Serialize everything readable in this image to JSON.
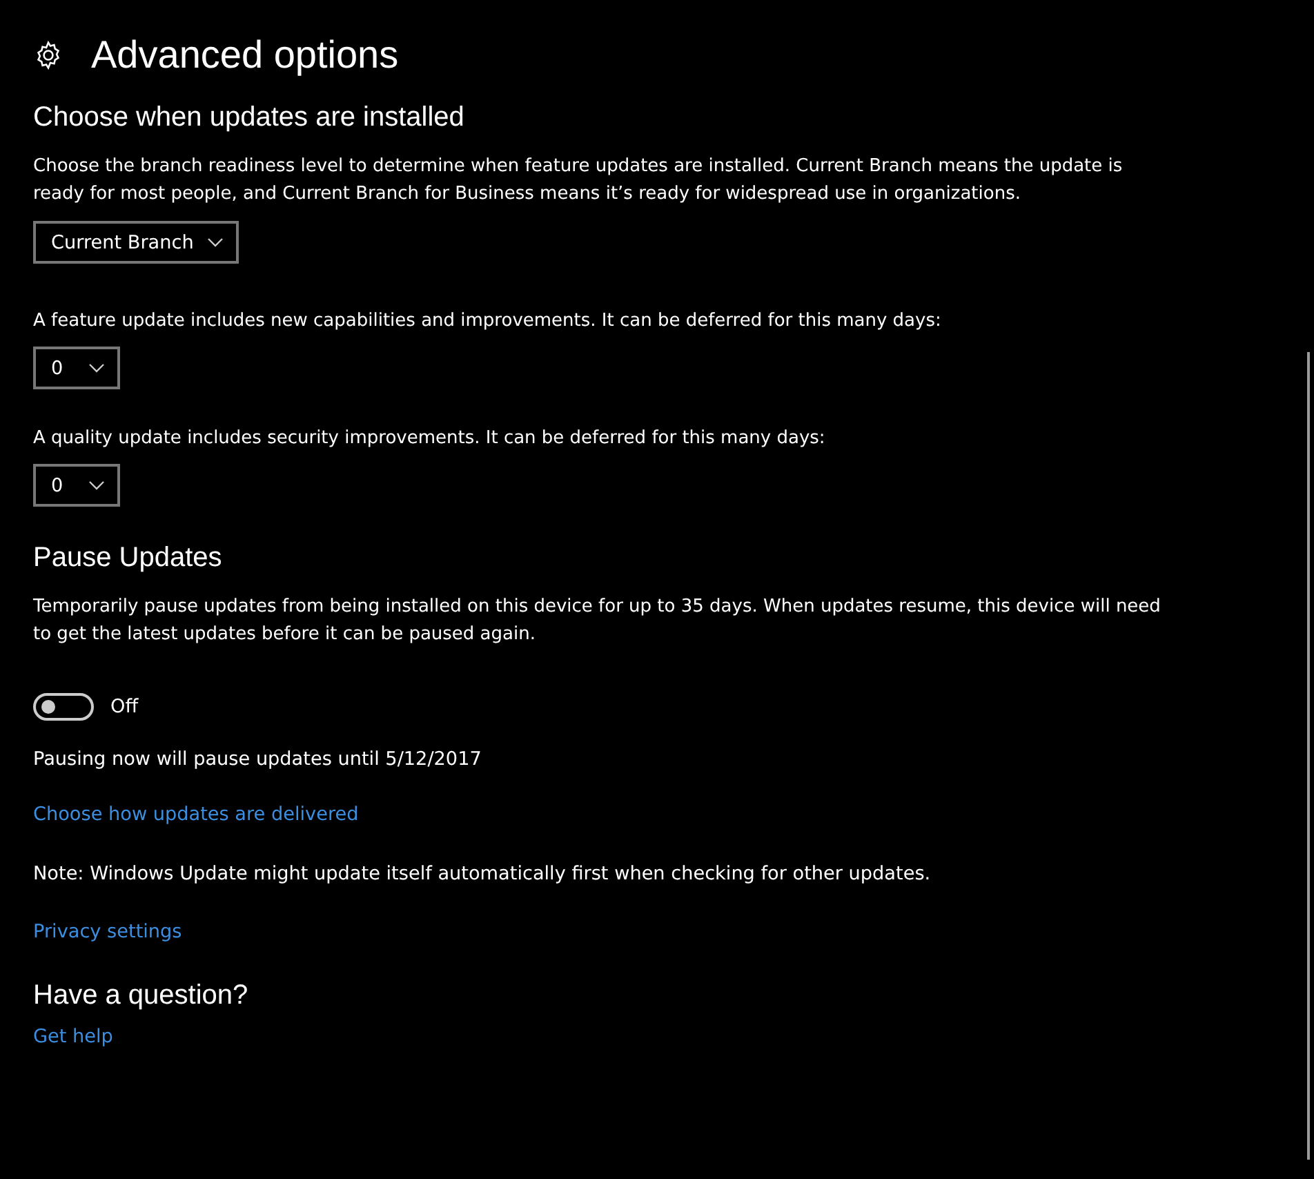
{
  "window": {
    "title": "Advanced options"
  },
  "sections": [
    {
      "kind": "install",
      "heading": "Choose when updates are installed",
      "description": "Choose the branch readiness level to determine when feature updates are installed. Current Branch means the update is ready for most people, and Current Branch for Business means it’s ready for widespread use in organizations.",
      "branch_dropdown": {
        "value": "Current Branch"
      },
      "deferrals": [
        {
          "label": "A feature update includes new capabilities and improvements. It can be deferred for this many days:",
          "value": "0"
        },
        {
          "label": "A quality update includes security improvements. It can be deferred for this many days:",
          "value": "0"
        }
      ]
    },
    {
      "kind": "pause",
      "heading": "Pause Updates",
      "description": "Temporarily pause updates from being installed on this device for up to 35 days. When updates resume, this device will need to get the latest updates before it can be paused again.",
      "toggle": {
        "on": false,
        "label": "Off"
      },
      "status": "Pausing now will pause updates until 5/12/2017"
    }
  ],
  "links_and_notes": [
    {
      "kind": "link",
      "text": "Choose how updates are delivered"
    },
    {
      "kind": "note",
      "text": "Note: Windows Update might update itself automatically first when checking for other updates."
    },
    {
      "kind": "link",
      "text": "Privacy settings"
    }
  ],
  "help": {
    "heading": "Have a question?",
    "link": "Get help"
  }
}
